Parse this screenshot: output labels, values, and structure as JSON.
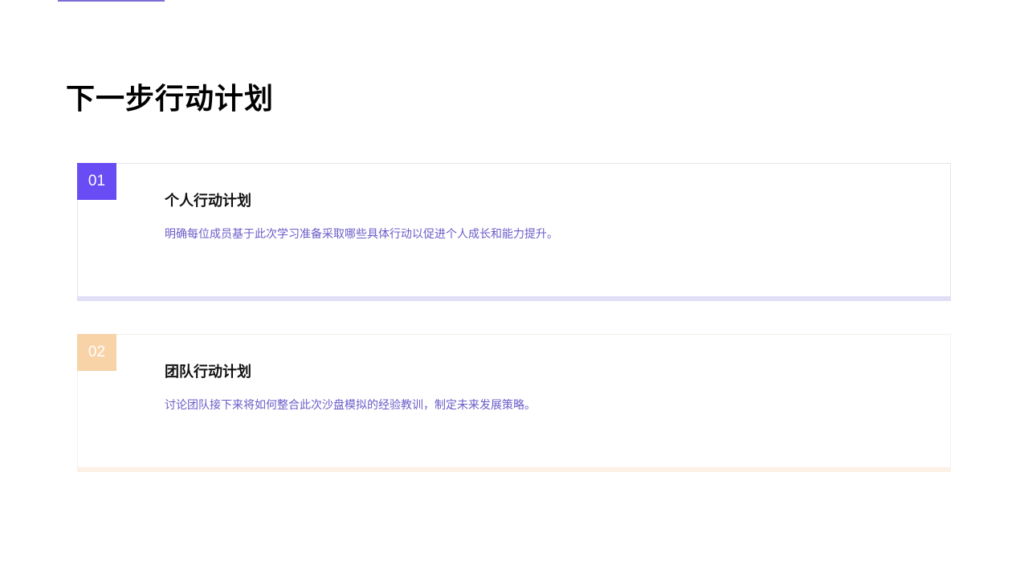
{
  "page": {
    "title": "下一步行动计划"
  },
  "cards": [
    {
      "number": "01",
      "title": "个人行动计划",
      "description": "明确每位成员基于此次学习准备采取哪些具体行动以促进个人成长和能力提升。"
    },
    {
      "number": "02",
      "title": "团队行动计划",
      "description": "讨论团队接下来将如何整合此次沙盘模拟的经验教训，制定未来发展策略。"
    }
  ],
  "colors": {
    "accent": "#6a4cf5",
    "secondary_accent": "#f8d3a8",
    "description_text": "#6a5cc8"
  }
}
